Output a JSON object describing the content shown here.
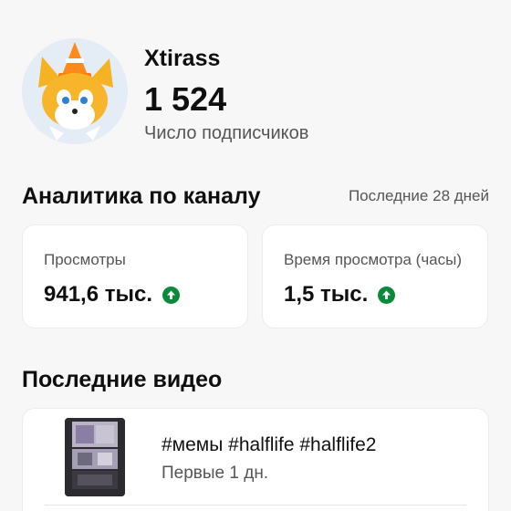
{
  "channel": {
    "name": "Xtirass",
    "subscribers": "1 524",
    "subscribers_label": "Число подписчиков"
  },
  "analytics": {
    "title": "Аналитика по каналу",
    "period": "Последние 28 дней",
    "cards": [
      {
        "label": "Просмотры",
        "value": "941,6 тыс.",
        "trend": "up"
      },
      {
        "label": "Время просмотра (часы)",
        "value": "1,5 тыс.",
        "trend": "up"
      }
    ]
  },
  "latest_videos": {
    "title": "Последние видео",
    "items": [
      {
        "title": "#мемы #halflife #halflife2",
        "subtitle": "Первые 1 дн."
      }
    ]
  },
  "colors": {
    "trend_up": "#0a8a3a",
    "card_bg": "#ffffff",
    "page_bg": "#f7f7f8"
  },
  "icons": [
    "avatar-tails-image",
    "trend-up-icon",
    "video-thumbnail"
  ]
}
